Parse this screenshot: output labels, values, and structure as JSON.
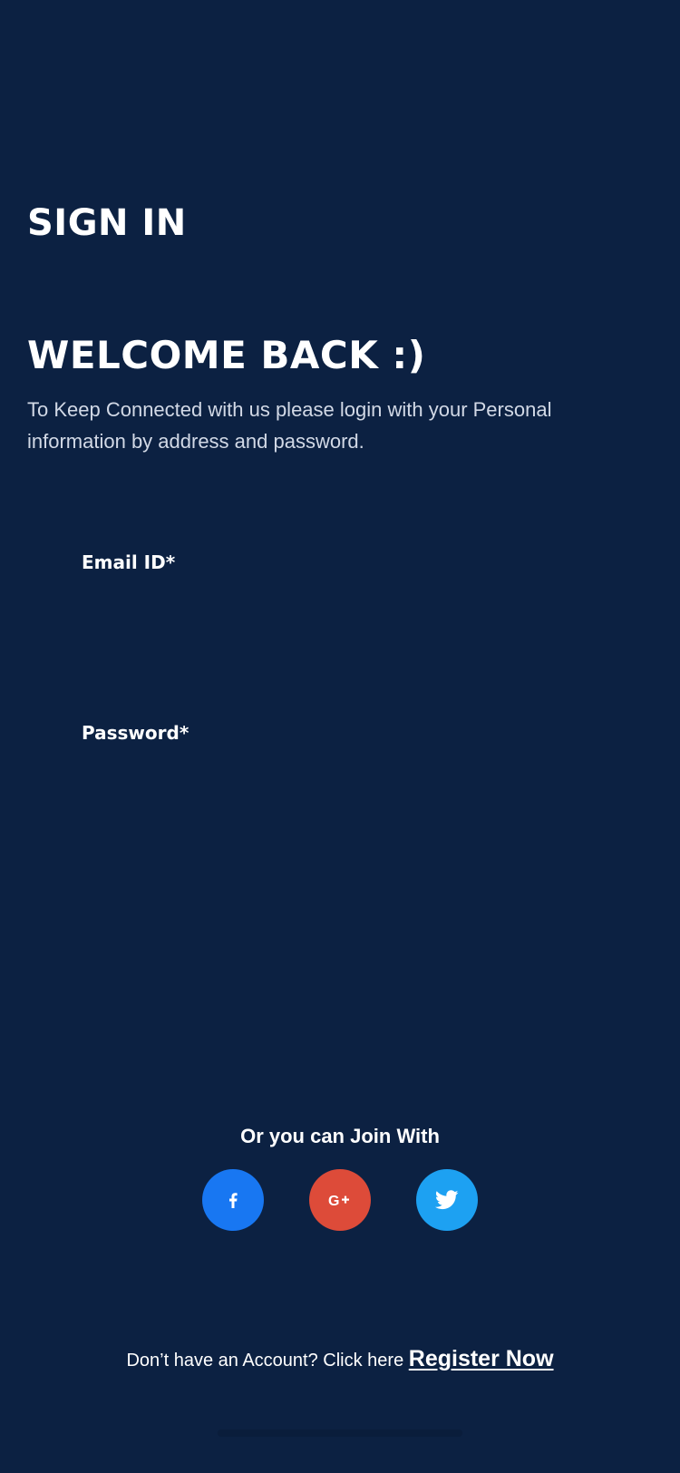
{
  "header": {
    "title": "SIGN IN"
  },
  "welcome": {
    "title": "WELCOME BACK :)",
    "description": "To Keep Connected with us please login with your Personal information by address and password."
  },
  "form": {
    "email": {
      "label": "Email ID*",
      "value": "",
      "placeholder": ""
    },
    "password": {
      "label": "Password*",
      "value": "",
      "placeholder": ""
    }
  },
  "social": {
    "prompt": "Or you can Join With",
    "buttons": [
      {
        "name": "facebook",
        "icon": "facebook-icon",
        "color": "#1877f2"
      },
      {
        "name": "google-plus",
        "icon": "google-plus-icon",
        "color": "#dd4b39"
      },
      {
        "name": "twitter",
        "icon": "twitter-icon",
        "color": "#1da1f2"
      }
    ]
  },
  "footer": {
    "prompt": "Don’t have an Account? Click here",
    "register_label": "Register Now"
  },
  "colors": {
    "background": "#0c2142",
    "text": "#ffffff",
    "muted_text": "#d2d9e6"
  }
}
